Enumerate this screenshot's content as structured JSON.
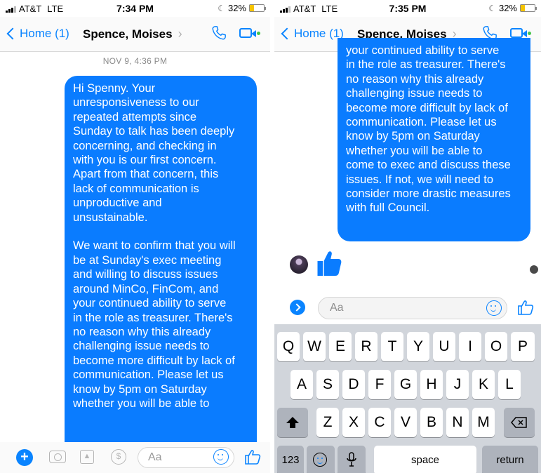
{
  "left": {
    "status": {
      "carrier": "AT&T",
      "network": "LTE",
      "time": "7:34 PM",
      "battery": "32%",
      "battery_level": 0.32
    },
    "nav": {
      "back_label": "Home (1)",
      "contact": "Spence, Moises",
      "chevron": "›"
    },
    "timestamp": "NOV 9, 4:36 PM",
    "message": "Hi Spenny. Your\nunresponsiveness to our\nrepeated attempts since\nSunday to talk has been deeply\nconcerning, and checking in\nwith you is our first concern.\nApart from that concern, this\nlack of communication is\nunproductive and\nunsustainable.\n\nWe want to confirm that you will\nbe at Sunday's exec meeting\nand willing to discuss issues\naround MinCo, FinCom, and\nyour continued ability to serve\nin the role as treasurer. There's\nno reason why this already\nchallenging issue needs to\nbecome more difficult by lack of\ncommunication. Please let us\nknow by 5pm on Saturday\nwhether you will be able to",
    "composer": {
      "placeholder": "Aa",
      "plus": "+",
      "money": "$"
    }
  },
  "right": {
    "status": {
      "carrier": "AT&T",
      "network": "LTE",
      "time": "7:35 PM",
      "battery": "32%",
      "battery_level": 0.32
    },
    "nav": {
      "back_label": "Home (1)",
      "contact": "Spence, Moises",
      "chevron": "›"
    },
    "message": "your continued ability to serve\nin the role as treasurer. There's\nno reason why this already\nchallenging issue needs to\nbecome more difficult by lack of\ncommunication. Please let us\nknow by 5pm on Saturday\nwhether you will be able to\ncome to exec and discuss these\nissues. If not, we will need to\nconsider more drastic measures\nwith full Council.",
    "composer": {
      "placeholder": "Aa"
    },
    "keyboard": {
      "row1": [
        "Q",
        "W",
        "E",
        "R",
        "T",
        "Y",
        "U",
        "I",
        "O",
        "P"
      ],
      "row2": [
        "A",
        "S",
        "D",
        "F",
        "G",
        "H",
        "J",
        "K",
        "L"
      ],
      "row3": [
        "Z",
        "X",
        "C",
        "V",
        "B",
        "N",
        "M"
      ],
      "numbers": "123",
      "space": "space",
      "return": "return"
    }
  },
  "icons": [
    "signal-icon",
    "moon-icon",
    "battery-icon",
    "back-chevron-icon",
    "phone-icon",
    "video-icon",
    "plus-icon",
    "camera-icon",
    "gallery-icon",
    "money-icon",
    "smile-icon",
    "thumbs-up-icon",
    "shift-icon",
    "delete-icon",
    "emoji-icon",
    "microphone-icon"
  ],
  "colors": {
    "accent": "#0a84ff",
    "bubble": "#0a7cff",
    "keyboard": "#d1d5db",
    "online": "#44c44a"
  }
}
